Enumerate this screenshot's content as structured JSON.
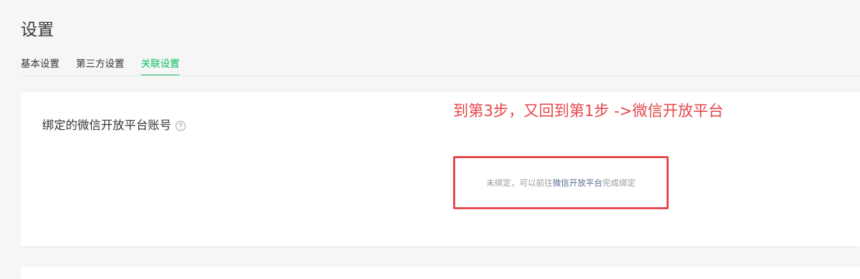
{
  "header": {
    "title": "设置"
  },
  "tabs": [
    {
      "label": "基本设置",
      "active": false
    },
    {
      "label": "第三方设置",
      "active": false
    },
    {
      "label": "关联设置",
      "active": true
    }
  ],
  "binding_card": {
    "label": "绑定的微信开放平台账号",
    "help_icon": "question-circle-icon",
    "hint_prefix": "未绑定，可以前往",
    "hint_link": "微信开放平台",
    "hint_suffix": "完成绑定"
  },
  "annotation": {
    "text": "到第3步，又回到第1步 ->微信开放平台"
  },
  "colors": {
    "accent": "#07c160",
    "annotation_red": "#e5474b",
    "link": "#576b95"
  }
}
